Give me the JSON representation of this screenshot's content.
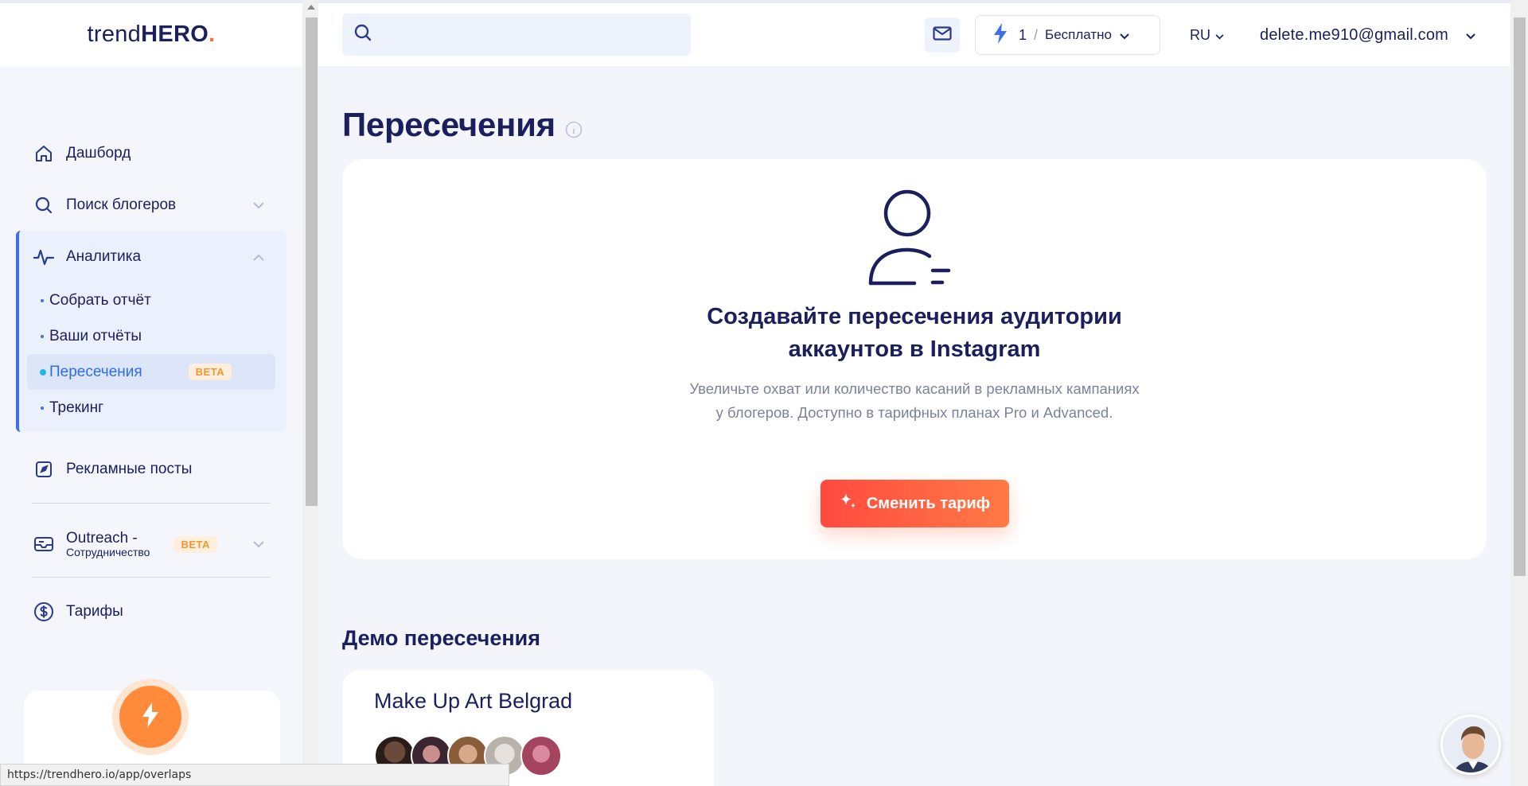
{
  "logo": {
    "prefix": "trend",
    "bold": "HERO",
    "dot": "."
  },
  "sidebar": {
    "dashboard": "Дашборд",
    "search_bloggers": "Поиск блогеров",
    "analytics": "Аналитика",
    "sub_items": [
      "Собрать отчёт",
      "Ваши отчёты",
      "Пересечения",
      "Трекинг"
    ],
    "beta": "BETA",
    "ad_posts": "Рекламные посты",
    "outreach_title": "Outreach -",
    "outreach_sub": "Сотрудничество",
    "tariffs": "Тарифы"
  },
  "topbar": {
    "search_placeholder": "",
    "credits": "1",
    "slash": "/",
    "plan": "Бесплатно",
    "lang": "RU",
    "email": "delete.me910@gmail.com"
  },
  "main": {
    "title": "Пересечения",
    "hero_title_line1": "Создавайте пересечения аудитории",
    "hero_title_line2": "аккаунтов в Instagram",
    "hero_desc": "Увеличьте охват или количество касаний в рекламных кампаниях у блогеров. Доступно в тарифных планах Pro и Advanced.",
    "cta": "Сменить тариф",
    "demo_title": "Демо пересечения",
    "demo_card_title": "Make Up Art Belgrad"
  },
  "status_url": "https://trendhero.io/app/overlaps",
  "colors": {
    "accent": "#3d6fe8",
    "brand_dark": "#1b1f5c",
    "cta_start": "#ff4a3f",
    "cta_end": "#ff7a45",
    "beta_bg": "#fdeede",
    "beta_text": "#f2972f"
  }
}
